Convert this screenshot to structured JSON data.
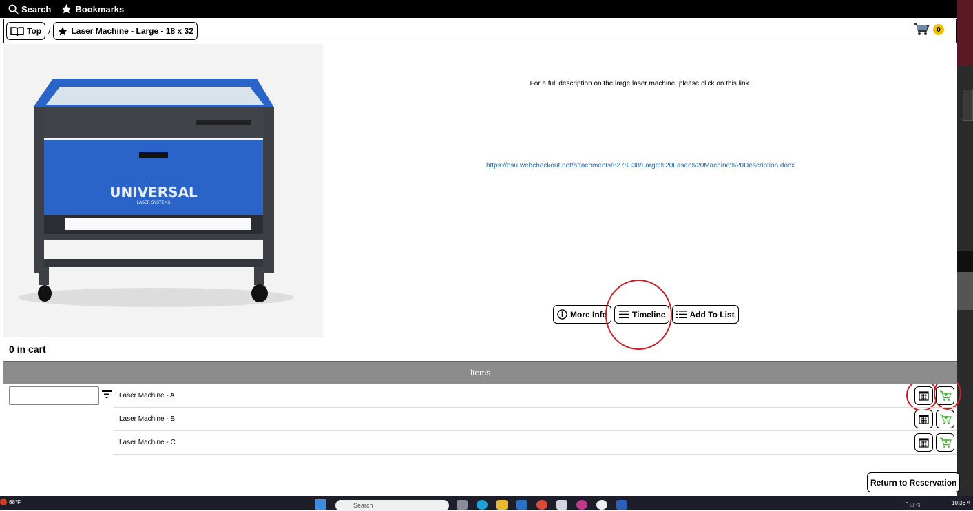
{
  "topbar": {
    "search_label": "Search",
    "bookmarks_label": "Bookmarks"
  },
  "breadcrumb": {
    "top_label": "Top",
    "separator": "/",
    "current_label": "Laser Machine - Large - 18 x 32"
  },
  "cart": {
    "count": "0"
  },
  "product": {
    "image_alt": "Universal Laser Systems laser machine",
    "brand_text": "UNIVERSAL",
    "brand_subtext": "LASER SYSTEMS"
  },
  "description": {
    "text": "For a full description on the large laser machine, please click on this link.",
    "link": "https://bsu.webcheckout.net/attachments/6278338/Large%20Laser%20Machine%20Description.docx"
  },
  "actions": {
    "more_info": "More Info",
    "timeline": "Timeline",
    "add_to_list": "Add To List"
  },
  "cart_count_label": "0 in cart",
  "items": {
    "header": "Items",
    "rows": [
      {
        "name": "Laser Machine - A"
      },
      {
        "name": "Laser Machine - B"
      },
      {
        "name": "Laser Machine - C"
      }
    ]
  },
  "return_label": "Return to Reservation",
  "taskbar": {
    "weather": "68°F",
    "search_placeholder": "Search",
    "time": "10:36 A"
  },
  "colors": {
    "annotation_red": "#c8202a",
    "cart_green": "#4caf3a",
    "link_blue": "#2a6fb5",
    "header_gray": "#8c8c8c"
  }
}
